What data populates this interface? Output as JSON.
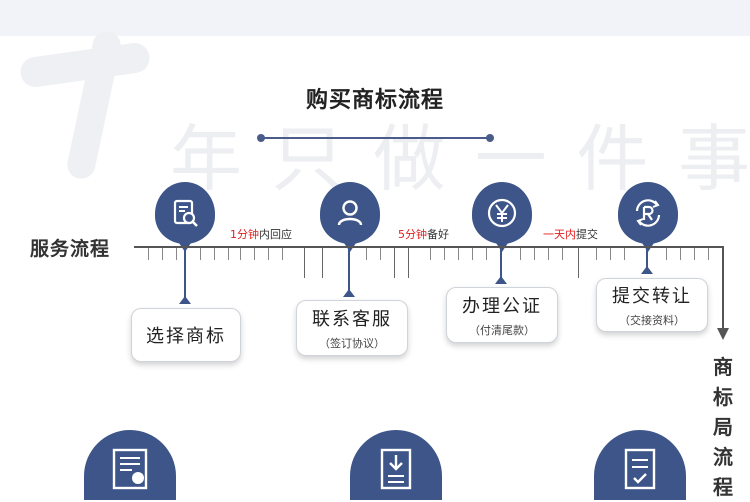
{
  "header": {
    "title": "购买商标流程"
  },
  "watermark": {
    "chars": [
      "年",
      "只",
      "做",
      "一",
      "件",
      "事"
    ]
  },
  "timeline": {
    "label": "服务流程",
    "notes": [
      {
        "red": "1分钟",
        "black": "内回应"
      },
      {
        "red": "5分钟",
        "black": "备好"
      },
      {
        "red": "一天内",
        "black": "提交"
      }
    ],
    "end_label": [
      "商",
      "标",
      "局",
      "流",
      "程"
    ]
  },
  "steps": [
    {
      "icon": "document-search-icon",
      "label": "选择商标",
      "sub": ""
    },
    {
      "icon": "customer-service-icon",
      "label": "联系客服",
      "sub": "（签订协议）"
    },
    {
      "icon": "yuan-icon",
      "label": "办理公证",
      "sub": "（付清尾款）"
    },
    {
      "icon": "registered-transfer-icon",
      "label": "提交转让",
      "sub": "（交接资料）"
    }
  ],
  "bottom_icons": [
    "certificate-icon",
    "download-document-icon",
    "checklist-icon"
  ],
  "colors": {
    "accent": "#3d5589",
    "highlight": "#e02020"
  }
}
